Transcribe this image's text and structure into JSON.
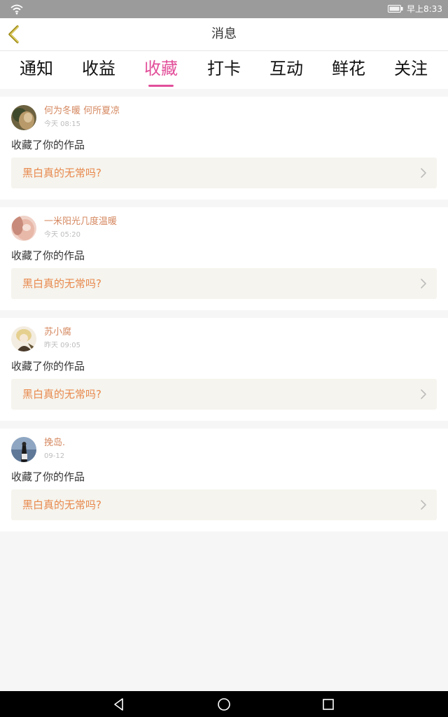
{
  "status_bar": {
    "time": "早上8:33",
    "wifi_icon": "wifi-icon",
    "battery_icon": "battery-icon"
  },
  "header": {
    "back_icon": "chevron-left-icon",
    "title": "消息"
  },
  "tabs": [
    {
      "label": "通知"
    },
    {
      "label": "收益"
    },
    {
      "label": "收藏",
      "active": true
    },
    {
      "label": "打卡"
    },
    {
      "label": "互动"
    },
    {
      "label": "鲜花"
    },
    {
      "label": "关注"
    }
  ],
  "messages": [
    {
      "user": "何为冬暖  何所夏凉",
      "time": "今天 08:15",
      "action": "收藏了你的作品",
      "work_title": "黑白真的无常吗?"
    },
    {
      "user": "一米阳光几度温暖",
      "time": "今天 05:20",
      "action": "收藏了你的作品",
      "work_title": "黑白真的无常吗?"
    },
    {
      "user": "苏小腐",
      "time": "昨天 09:05",
      "action": "收藏了你的作品",
      "work_title": "黑白真的无常吗?"
    },
    {
      "user": "挽岛.",
      "time": "09-12",
      "action": "收藏了你的作品",
      "work_title": "黑白真的无常吗?"
    }
  ],
  "nav_bar": {
    "back_icon": "triangle-back-icon",
    "home_icon": "circle-home-icon",
    "recents_icon": "square-recents-icon"
  },
  "colors": {
    "accent": "#e24f9a",
    "username": "#d58860",
    "work_title": "#e8894d"
  }
}
